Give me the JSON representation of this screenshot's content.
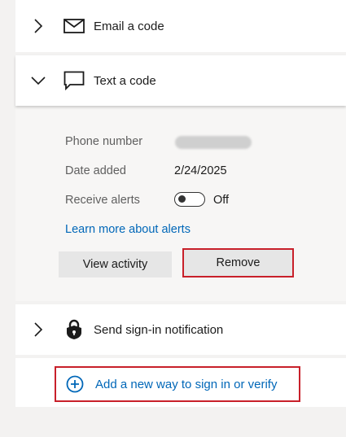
{
  "methods": {
    "email": {
      "label": "Email a code",
      "icon": "envelope-icon"
    },
    "text": {
      "label": "Text a code",
      "icon": "message-icon"
    },
    "signin": {
      "label": "Send sign-in notification",
      "icon": "lock-icon"
    }
  },
  "details": {
    "phone_label": "Phone number",
    "date_label": "Date added",
    "date_value": "2/24/2025",
    "alerts_label": "Receive alerts",
    "alerts_state": "Off",
    "learn_more": "Learn more about alerts",
    "view_activity": "View activity",
    "remove": "Remove"
  },
  "add_method": {
    "label": "Add a new way to sign in or verify",
    "icon": "plus-circle-icon"
  },
  "colors": {
    "link": "#0067b8",
    "highlight": "#c8202a",
    "background": "#f3f2f1"
  }
}
